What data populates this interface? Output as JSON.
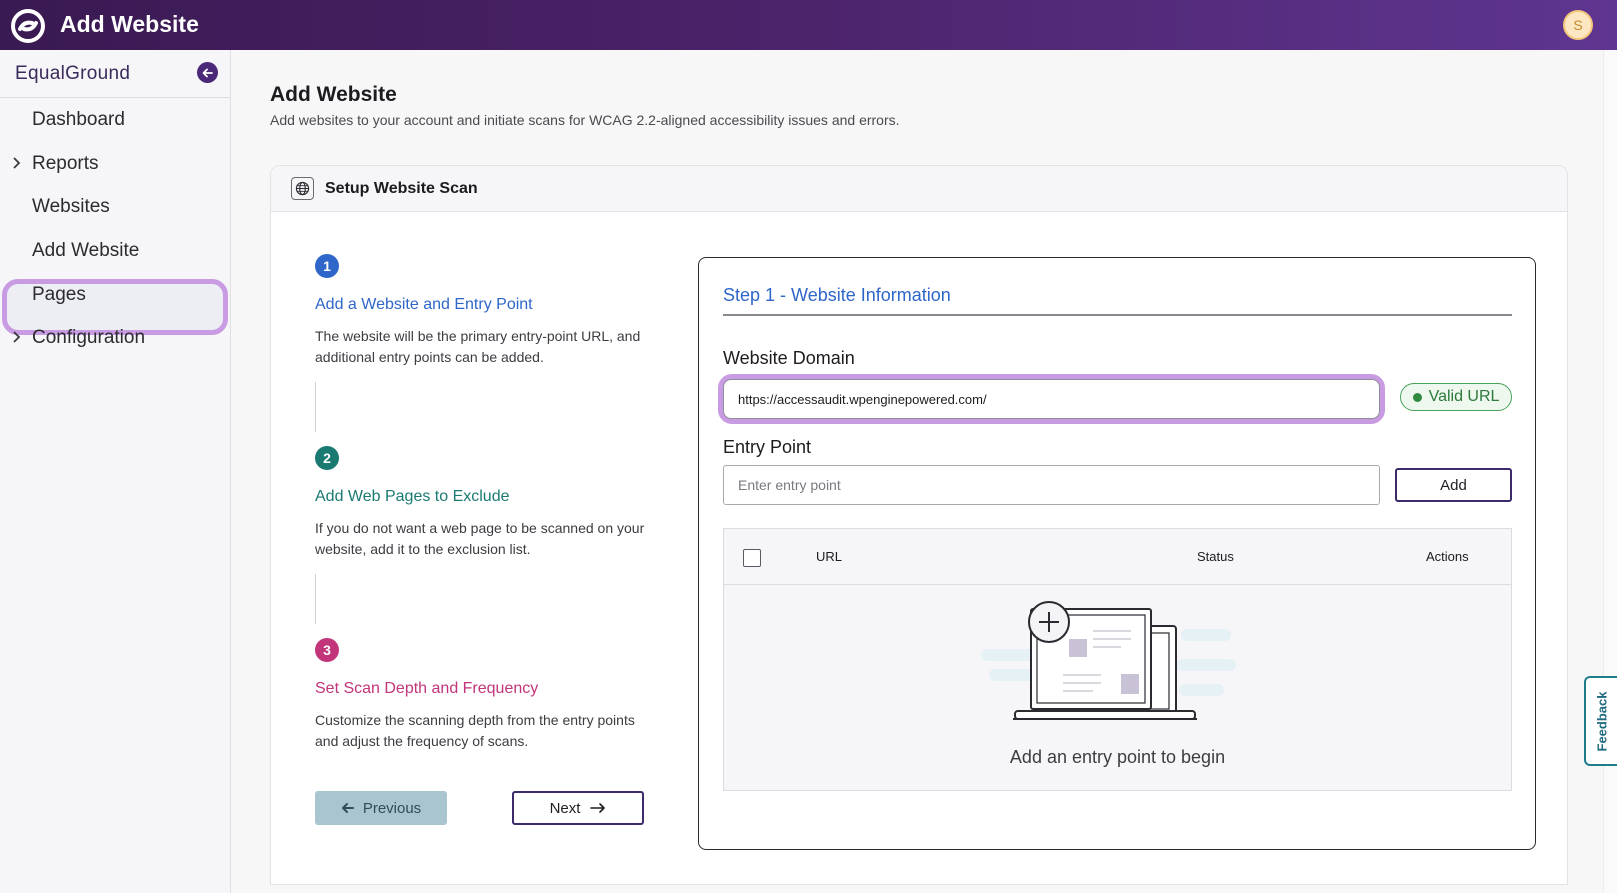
{
  "header": {
    "title": "Add Website",
    "avatar_initial": "S"
  },
  "sidebar": {
    "org_name": "EqualGround",
    "items": [
      {
        "label": "Dashboard",
        "expandable": false
      },
      {
        "label": "Reports",
        "expandable": true
      },
      {
        "label": "Websites",
        "expandable": false
      },
      {
        "label": "Add Website",
        "expandable": false,
        "active": true
      },
      {
        "label": "Pages",
        "expandable": false
      },
      {
        "label": "Configuration",
        "expandable": true
      }
    ]
  },
  "page": {
    "title": "Add Website",
    "subtitle": "Add websites to your account and initiate scans for WCAG 2.2-aligned accessibility issues and errors."
  },
  "card": {
    "title": "Setup Website Scan"
  },
  "steps": [
    {
      "number": "1",
      "title": "Add a Website and Entry Point",
      "description": "The website will be the primary entry-point URL, and additional entry points can be added.",
      "color": "#2e66c9"
    },
    {
      "number": "2",
      "title": "Add Web Pages to Exclude",
      "description": "If you do not want a web page to be scanned on your website, add it to the exclusion list.",
      "color": "#1a7a72"
    },
    {
      "number": "3",
      "title": "Set Scan Depth and Frequency",
      "description": "Customize the scanning depth from the entry points and adjust the frequency of scans.",
      "color": "#c2357a"
    }
  ],
  "nav_buttons": {
    "previous": "Previous",
    "next": "Next"
  },
  "form": {
    "step_title": "Step 1 - Website Information",
    "domain_label": "Website Domain",
    "domain_value": "https://accessaudit.wpenginepowered.com/",
    "valid_badge": "Valid URL",
    "entry_label": "Entry Point",
    "entry_placeholder": "Enter entry point",
    "add_button": "Add"
  },
  "table": {
    "columns": [
      "URL",
      "Status",
      "Actions"
    ],
    "empty_text": "Add an entry point to begin"
  },
  "feedback_label": "Feedback",
  "colors": {
    "brand_purple": "#4a2268",
    "highlight": "#c89be3",
    "link_blue": "#2e66c9",
    "valid_green": "#2c7a3b"
  }
}
